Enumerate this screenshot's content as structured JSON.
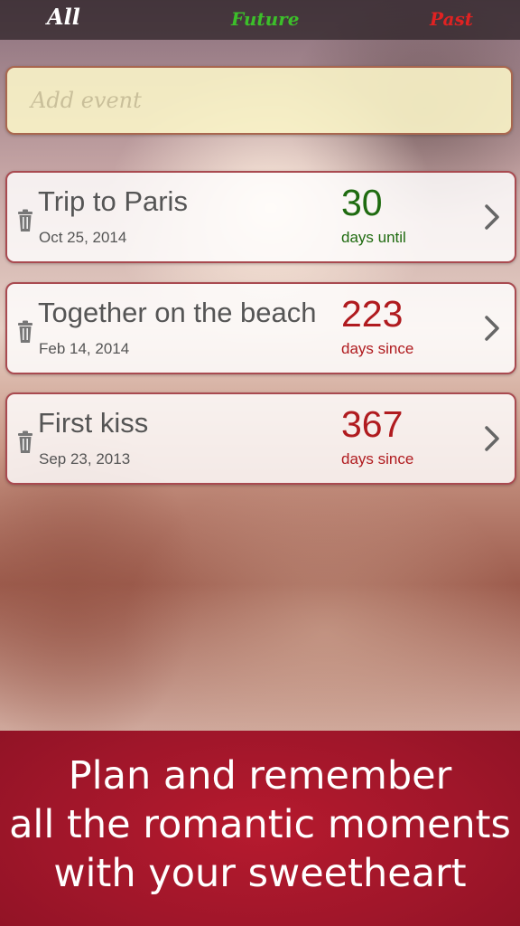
{
  "tabs": {
    "all": "All",
    "future": "Future",
    "past": "Past"
  },
  "add_event": {
    "placeholder": "Add event"
  },
  "events": [
    {
      "title": "Trip to Paris",
      "date": "Oct 25, 2014",
      "count": "30",
      "count_label": "days until",
      "status": "future"
    },
    {
      "title": "Together on the beach",
      "date": "Feb 14, 2014",
      "count": "223",
      "count_label": "days since",
      "status": "past"
    },
    {
      "title": "First kiss",
      "date": "Sep 23, 2013",
      "count": "367",
      "count_label": "days since",
      "status": "past"
    }
  ],
  "banner": {
    "line1": "Plan and remember",
    "line2": "all the romantic moments",
    "line3": "with your sweetheart"
  },
  "colors": {
    "future_accent": "#1f6b10",
    "past_accent": "#b01b1f",
    "banner_red": "#a0162a"
  },
  "icons": [
    "trash-icon",
    "chevron-right-icon"
  ]
}
